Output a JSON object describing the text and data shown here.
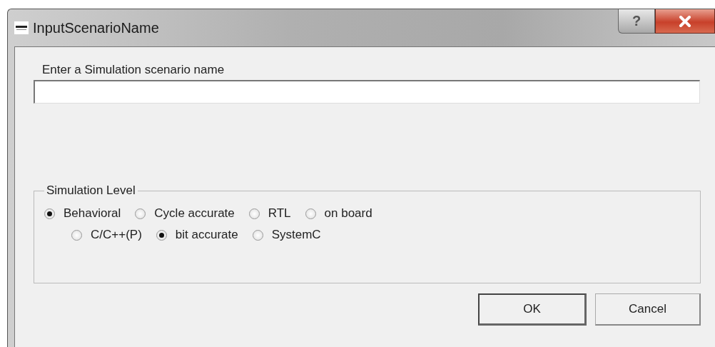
{
  "window": {
    "title": "InputScenarioName",
    "help_button": "?"
  },
  "name_field": {
    "label": "Enter a Simulation scenario name"
  },
  "simulation_level": {
    "title": "Simulation Level",
    "option_rows": [
      [
        {
          "label": "Behavioral",
          "selected": true
        },
        {
          "label": "Cycle accurate",
          "selected": false
        },
        {
          "label": "RTL",
          "selected": false
        },
        {
          "label": "on board",
          "selected": false
        }
      ],
      [
        {
          "label": "C/C++(P)",
          "selected": false
        },
        {
          "label": "bit accurate",
          "selected": true
        },
        {
          "label": "SystemC",
          "selected": false
        }
      ]
    ]
  },
  "buttons": [
    {
      "label": "OK",
      "kind": "default"
    },
    {
      "label": "Cancel",
      "kind": "normal"
    }
  ]
}
